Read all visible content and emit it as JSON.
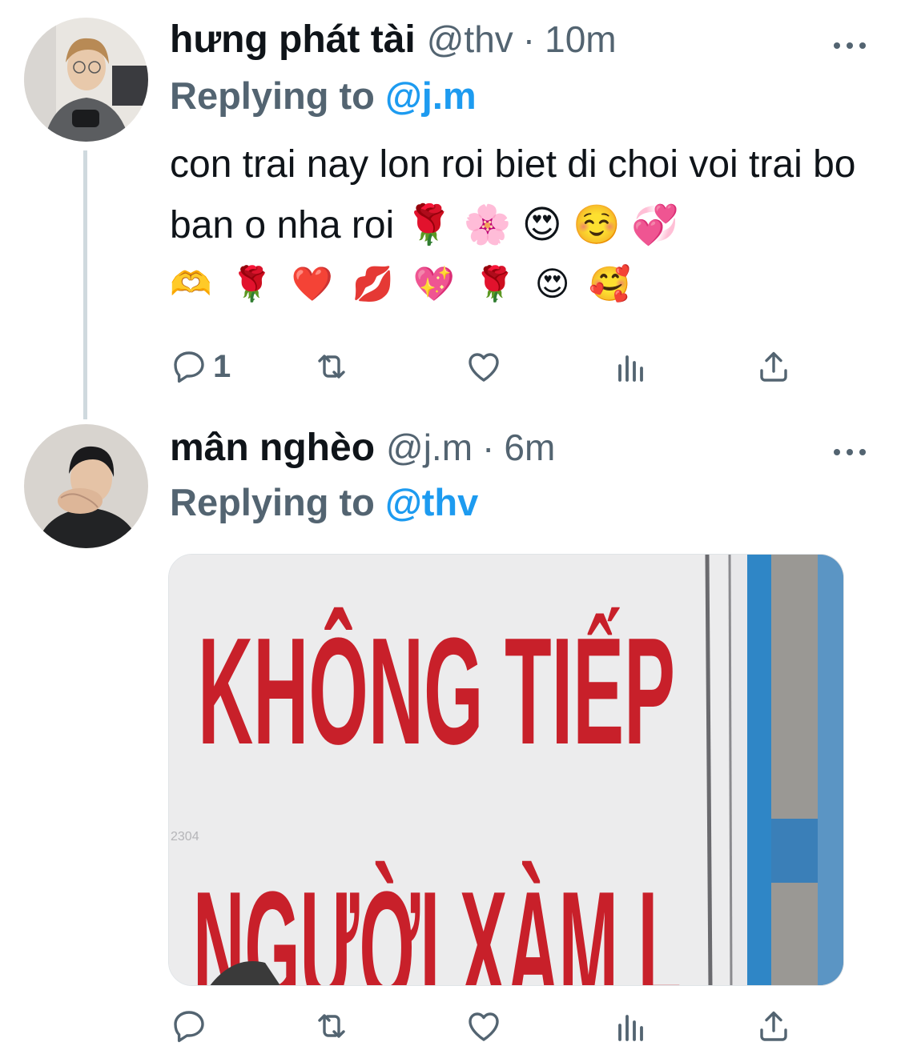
{
  "tweets": [
    {
      "display_name": "hưng phát tài",
      "handle": "@thv",
      "time": "10m",
      "replying_prefix": "Replying to",
      "replying_to": "@j.m",
      "text": "con trai nay lon roi biet di choi voi trai bo ban o nha roi 🌹 🌸 😍 ☺️ 💞",
      "emoji_line": "🫶 🌹 ❤️ 💋 💖 🌹 😍 🥰",
      "reply_count": "1",
      "icons": [
        "reply-icon",
        "retweet-icon",
        "like-icon",
        "views-icon",
        "share-icon",
        "more-icon"
      ]
    },
    {
      "display_name": "mân nghèo",
      "handle": "@j.m",
      "time": "6m",
      "replying_prefix": "Replying to",
      "replying_to": "@thv",
      "media": {
        "sign_line1": "KHÔNG TIẾP",
        "sign_line2": "NGƯỜI XÀM L",
        "watermark": "2304"
      },
      "icons": [
        "reply-icon",
        "retweet-icon",
        "like-icon",
        "views-icon",
        "share-icon",
        "more-icon"
      ]
    }
  ],
  "colors": {
    "text": "#0f1419",
    "secondary": "#536471",
    "link": "#1d9bf0",
    "thread_line": "#cfd9de",
    "sign_red": "#c8202a"
  }
}
